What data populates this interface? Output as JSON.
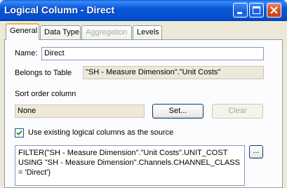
{
  "window": {
    "title": "Logical Column - Direct"
  },
  "tabs": [
    {
      "label": "General",
      "active": true,
      "enabled": true
    },
    {
      "label": "Data Type",
      "active": false,
      "enabled": true
    },
    {
      "label": "Aggregation",
      "active": false,
      "enabled": false
    },
    {
      "label": "Levels",
      "active": false,
      "enabled": true
    }
  ],
  "general": {
    "name_label": "Name:",
    "name_value": "Direct",
    "belongs_label": "Belongs to Table",
    "belongs_value": "\"SH - Measure Dimension\".\"Unit Costs\"",
    "sort_label": "Sort order column",
    "sort_value": "None",
    "set_button": "Set...",
    "clear_button": "Clear",
    "use_existing_label": "Use existing logical columns as the source",
    "use_existing_checked": true,
    "expression": "FILTER(\"SH - Measure Dimension\".\"Unit Costs\".UNIT_COST\nUSING \"SH - Measure Dimension\".Channels.CHANNEL_CLASS\n= 'Direct')",
    "browse_button": "..."
  },
  "titlebar_buttons": {
    "minimize": "minimize-icon",
    "maximize": "maximize-icon",
    "close": "close-icon"
  },
  "colors": {
    "titlebar": "#0756d8",
    "dialog_bg": "#ece9d8",
    "tab_highlight": "#f5b43b"
  }
}
